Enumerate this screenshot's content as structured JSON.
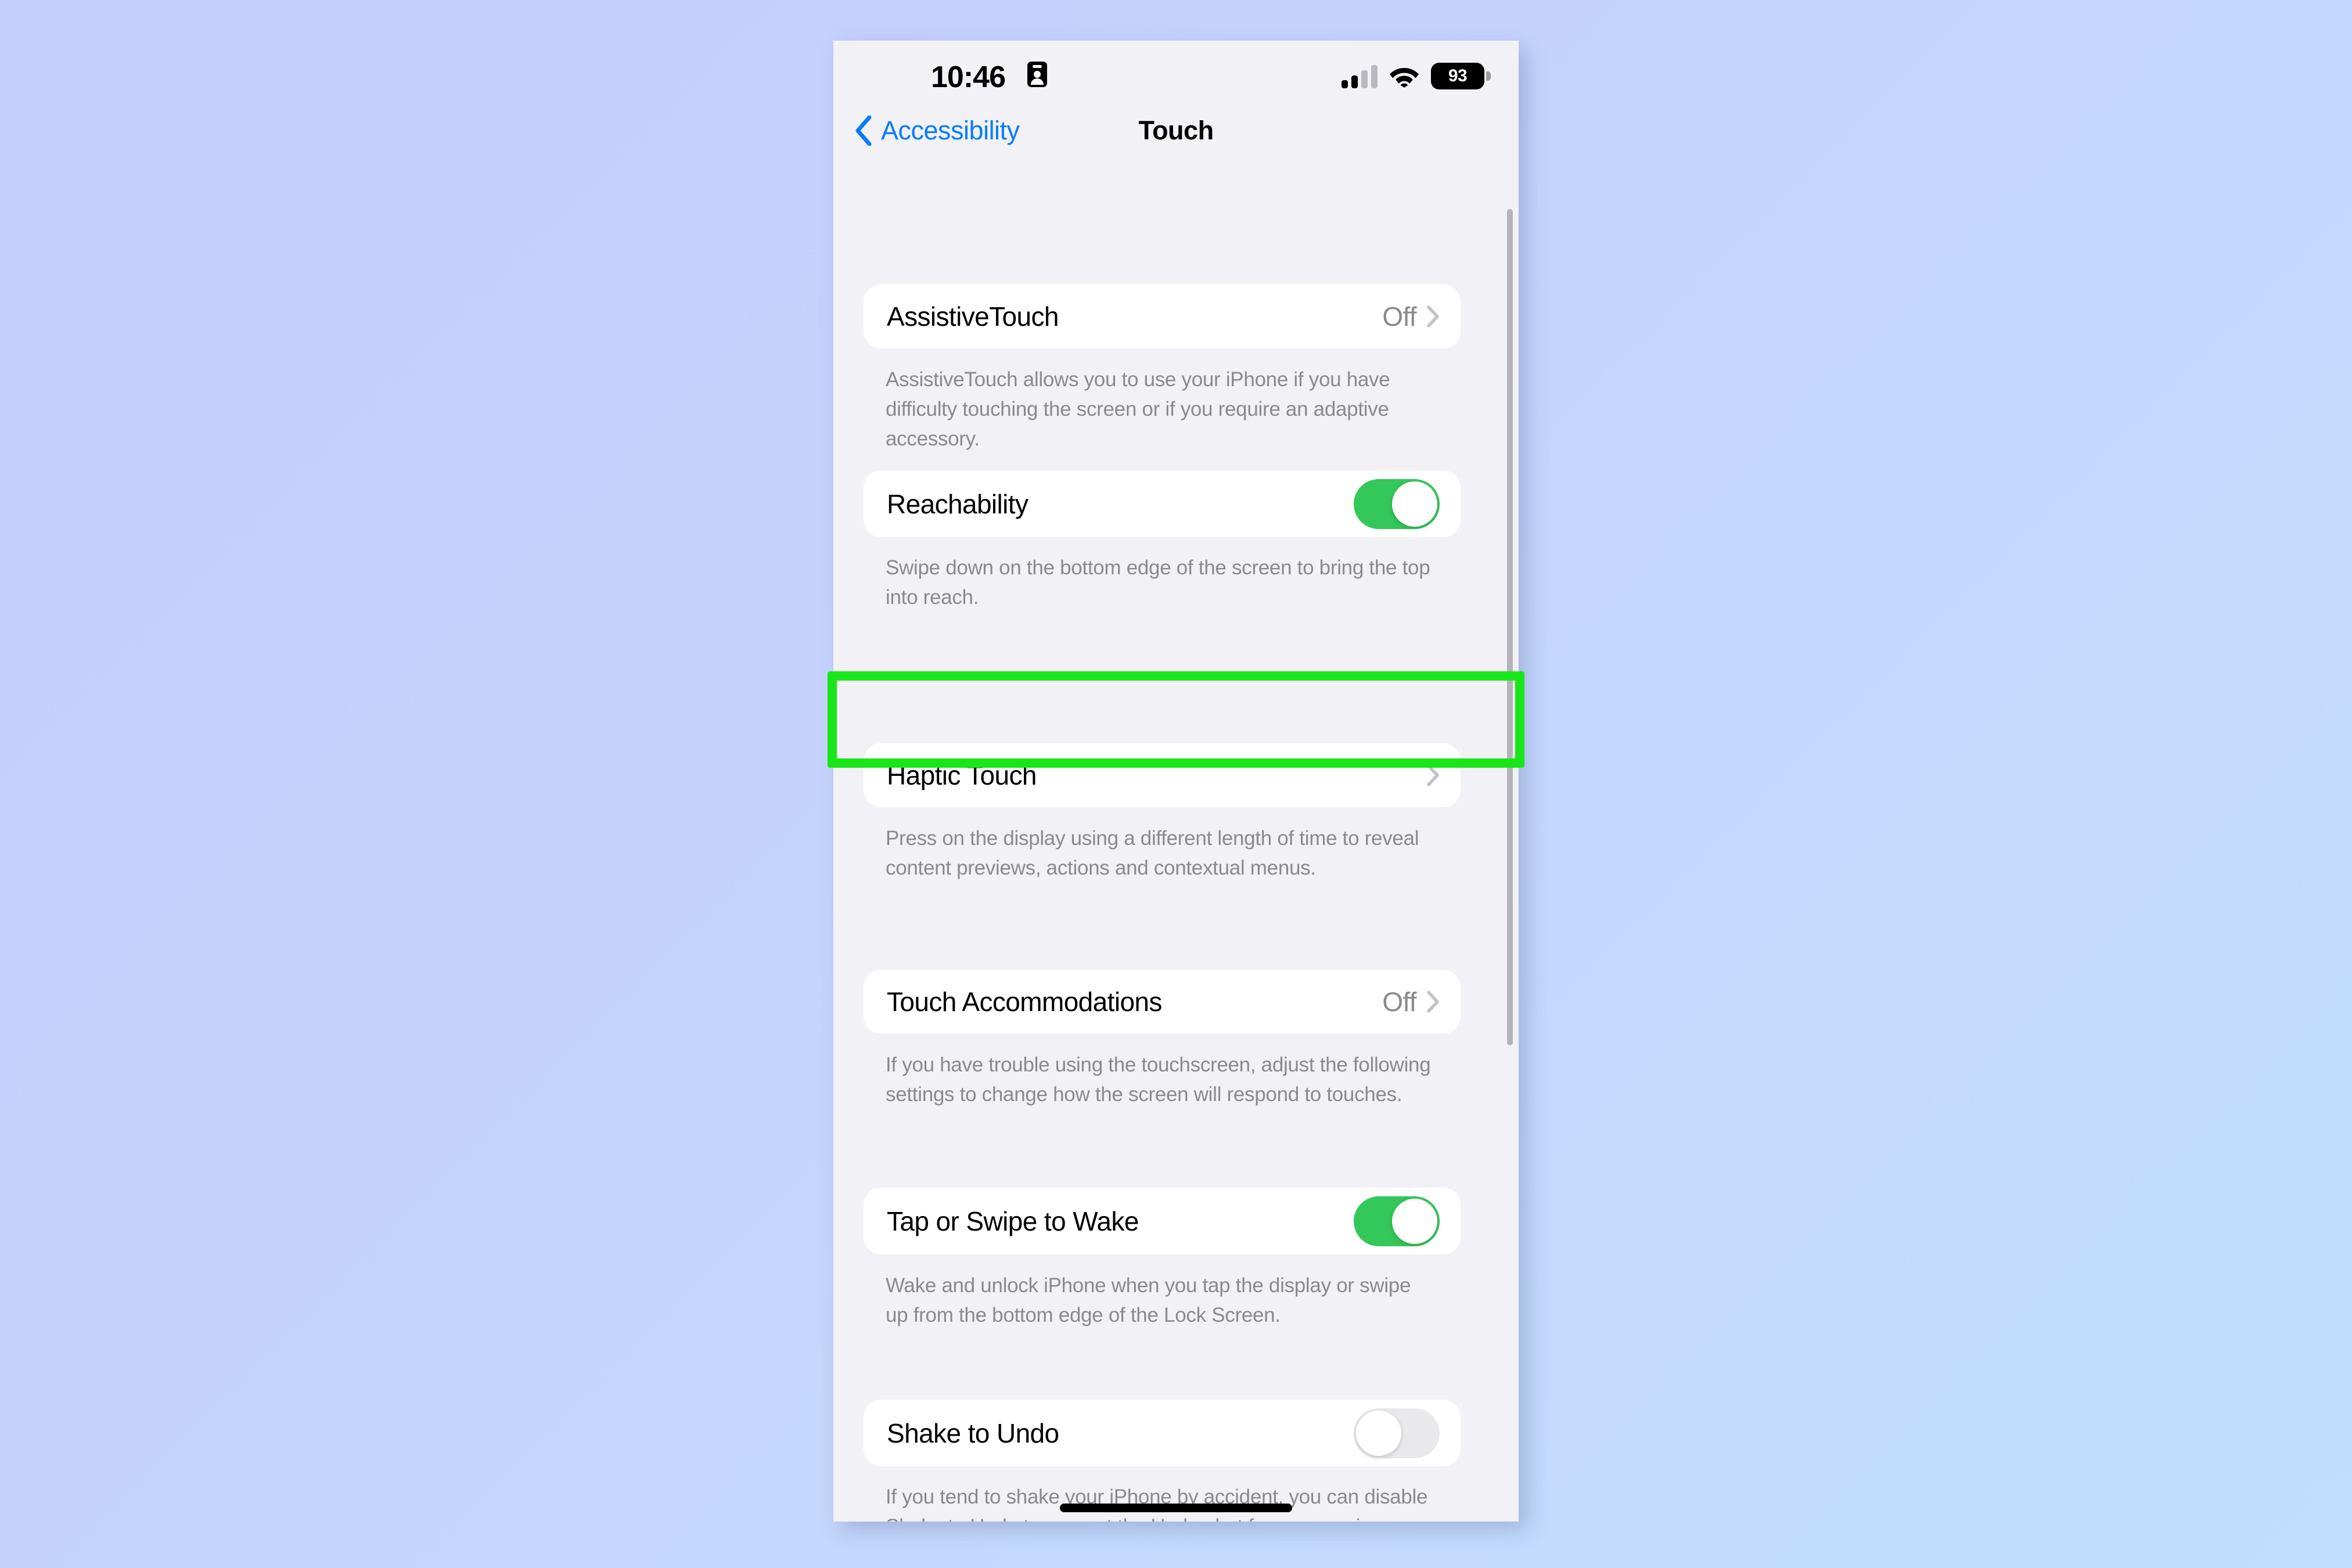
{
  "theme": {
    "accent_blue": "#067cfc",
    "toggle_on_green": "#34c759",
    "highlight_green": "#19e619",
    "secondary_text": "#8a8a8e",
    "screen_bg": "#f2f1f6",
    "card_bg": "#ffffff"
  },
  "status_bar": {
    "time": "10:46",
    "focus_icon": "contact-card-icon",
    "signal_icon": "cellular-signal-icon",
    "signal_bars_active": 2,
    "signal_bars_total": 4,
    "wifi_icon": "wifi-icon",
    "battery_percent": "93",
    "battery_icon": "battery-icon"
  },
  "nav_bar": {
    "back_icon": "chevron-left-icon",
    "back_label": "Accessibility",
    "title": "Touch"
  },
  "settings": [
    {
      "label": "AssistiveTouch",
      "type": "disclosure",
      "value": "Off",
      "chevron_icon": "chevron-right-icon",
      "footnote": "AssistiveTouch allows you to use your iPhone if you have difficulty touching the screen or if you require an adaptive accessory.",
      "highlighted": false
    },
    {
      "label": "Reachability",
      "type": "toggle",
      "toggle_state": "on",
      "footnote": "Swipe down on the bottom edge of the screen to bring the top into reach.",
      "highlighted": false
    },
    {
      "label": "Haptic Touch",
      "type": "disclosure",
      "value": "",
      "chevron_icon": "chevron-right-icon",
      "footnote": "Press on the display using a different length of time to reveal content previews, actions and contextual menus.",
      "highlighted": true
    },
    {
      "label": "Touch Accommodations",
      "type": "disclosure",
      "value": "Off",
      "chevron_icon": "chevron-right-icon",
      "footnote": "If you have trouble using the touchscreen, adjust the following settings to change how the screen will respond to touches.",
      "highlighted": false
    },
    {
      "label": "Tap or Swipe to Wake",
      "type": "toggle",
      "toggle_state": "on",
      "footnote": "Wake and unlock iPhone when you tap the display or swipe up from the bottom edge of the Lock Screen.",
      "highlighted": false
    },
    {
      "label": "Shake to Undo",
      "type": "toggle",
      "toggle_state": "off",
      "footnote": "If you tend to shake your iPhone by accident, you can disable Shake to Undo to prevent the Undo alert from appearing.",
      "highlighted": false
    }
  ],
  "scrollbar": {
    "name": "vertical-scrollbar"
  },
  "home_indicator": {
    "name": "home-indicator"
  }
}
